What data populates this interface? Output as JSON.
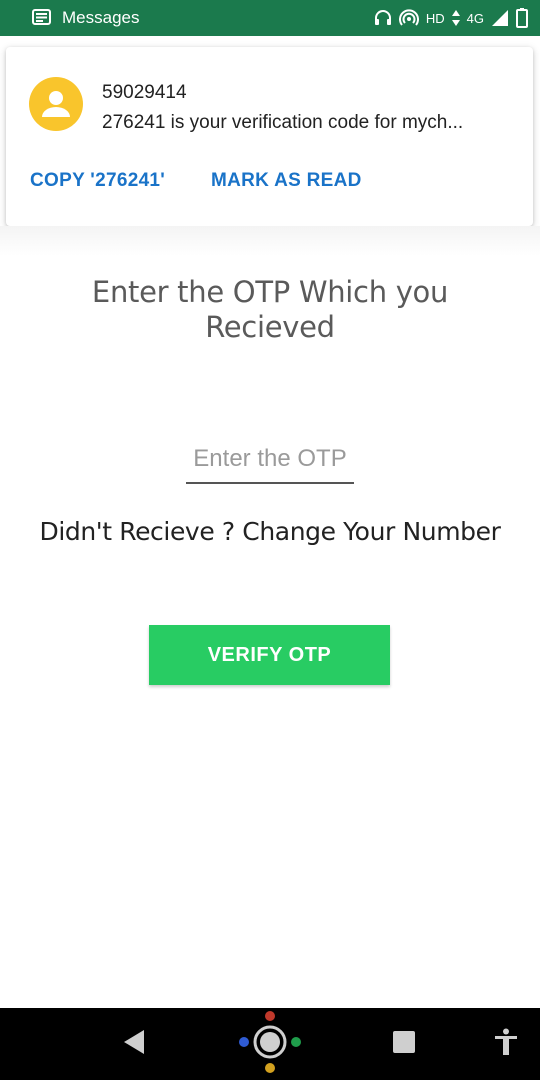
{
  "status_bar": {
    "app_label": "Messages",
    "hd": "HD",
    "network": "4G",
    "icons": [
      "messages-icon",
      "headset-icon",
      "hotspot-icon",
      "data-arrows-icon",
      "signal-icon",
      "battery-icon"
    ]
  },
  "notification": {
    "sender": "59029414",
    "message": "276241 is your verification code for mych...",
    "actions": {
      "copy": "COPY '276241'",
      "mark_read": "MARK AS READ"
    },
    "avatar_color": "#f9c52c"
  },
  "page": {
    "title": "Enter the OTP Which you Recieved",
    "otp_input": {
      "placeholder": "Enter the OTP",
      "value": ""
    },
    "change_number": "Didn't Recieve ? Change Your Number",
    "verify_button": "VERIFY OTP"
  },
  "nav_bar": {
    "icons": [
      "back-icon",
      "assistant-home-icon",
      "recents-icon",
      "accessibility-icon"
    ]
  },
  "colors": {
    "status_bar": "#1b7a4d",
    "action_link": "#1a73c8",
    "verify_button": "#28cc63"
  }
}
